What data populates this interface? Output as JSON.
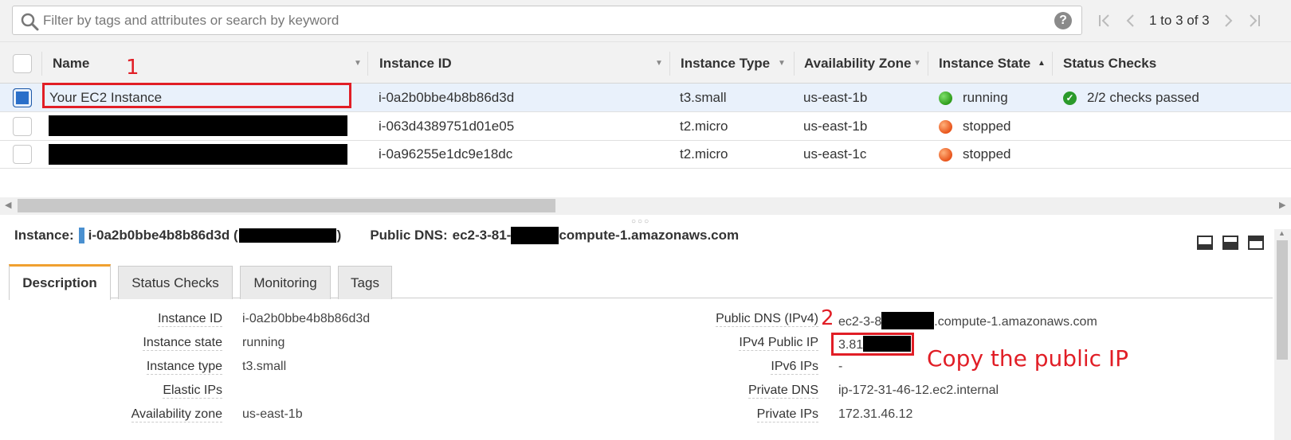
{
  "search": {
    "placeholder": "Filter by tags and attributes or search by keyword",
    "help_symbol": "?"
  },
  "pager": {
    "text": "1 to 3 of 3",
    "first": "|‹",
    "prev": "‹",
    "next": "›",
    "last": "›|"
  },
  "table": {
    "columns": [
      "Name",
      "Instance ID",
      "Instance Type",
      "Availability Zone",
      "Instance State",
      "Status Checks"
    ],
    "rows": [
      {
        "name": "Your EC2 Instance",
        "selected": true,
        "instance_id": "i-0a2b0bbe4b8b86d3d",
        "type": "t3.small",
        "zone": "us-east-1b",
        "state": "running",
        "state_color": "#2e9c1a",
        "checks": "2/2 checks passed"
      },
      {
        "name": "",
        "selected": false,
        "instance_id": "i-063d4389751d01e05",
        "type": "t2.micro",
        "zone": "us-east-1b",
        "state": "stopped",
        "state_color": "#e8541b",
        "checks": ""
      },
      {
        "name": "",
        "selected": false,
        "instance_id": "i-0a96255e1dc9e18dc",
        "type": "t2.micro",
        "zone": "us-east-1c",
        "state": "stopped",
        "state_color": "#e8541b",
        "checks": ""
      }
    ]
  },
  "annotations": {
    "step1": "1",
    "step2": "2",
    "copy_note": "Copy the public IP",
    "color": "#e11e26"
  },
  "detail": {
    "instance_label": "Instance:",
    "instance_id": "i-0a2b0bbe4b8b86d3d (",
    "instance_close": ")",
    "dns_label": "Public DNS:",
    "dns_prefix": "ec2-3-81-",
    "dns_suffix": "compute-1.amazonaws.com"
  },
  "tabs": [
    "Description",
    "Status Checks",
    "Monitoring",
    "Tags"
  ],
  "description": {
    "left": [
      {
        "label": "Instance ID",
        "value": "i-0a2b0bbe4b8b86d3d"
      },
      {
        "label": "Instance state",
        "value": "running"
      },
      {
        "label": "Instance type",
        "value": "t3.small"
      },
      {
        "label": "Elastic IPs",
        "value": ""
      },
      {
        "label": "Availability zone",
        "value": "us-east-1b"
      }
    ],
    "right": [
      {
        "label": "Public DNS (IPv4)",
        "value_prefix": "ec2-3-8",
        "value_suffix": ".compute-1.amazonaws.com"
      },
      {
        "label": "IPv4 Public IP",
        "value": "3.81"
      },
      {
        "label": "IPv6 IPs",
        "value": "-"
      },
      {
        "label": "Private DNS",
        "value": "ip-172-31-46-12.ec2.internal"
      },
      {
        "label": "Private IPs",
        "value": "172.31.46.12"
      }
    ]
  }
}
